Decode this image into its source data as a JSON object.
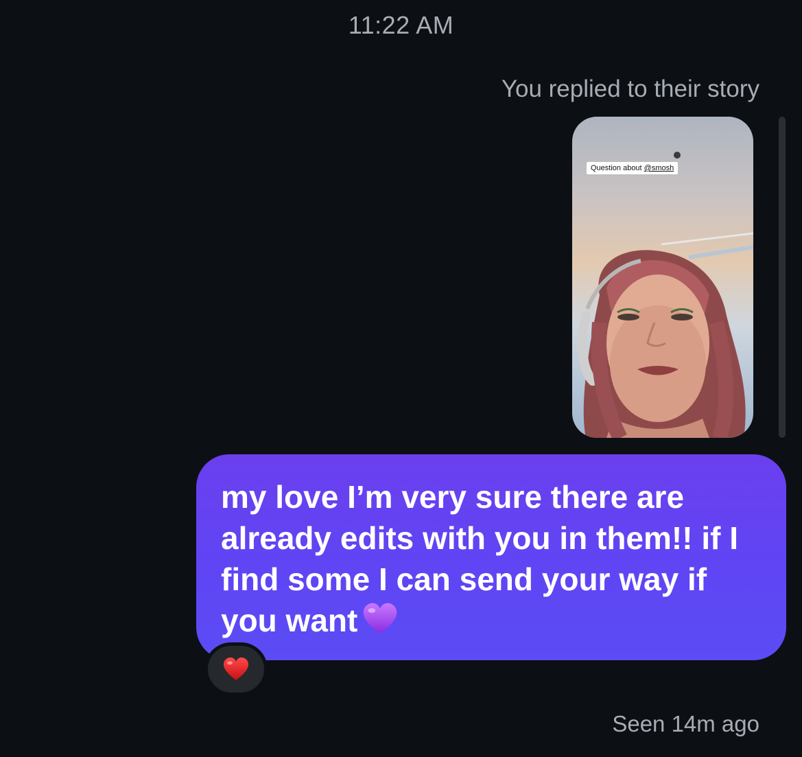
{
  "header": {
    "timestamp": "11:22 AM"
  },
  "story_reply": {
    "note": "You replied to their story",
    "thumbnail": {
      "sticker_prefix": "Question about ",
      "sticker_mention": "@smosh"
    }
  },
  "message": {
    "text": "my love I’m very sure there are already edits with you in them!! if I find some I can send your way if you want",
    "emoji": "purple-heart-icon",
    "bubble_color": "#5f45f4",
    "reaction": "red-heart-icon"
  },
  "status": {
    "seen": "Seen 14m ago"
  }
}
